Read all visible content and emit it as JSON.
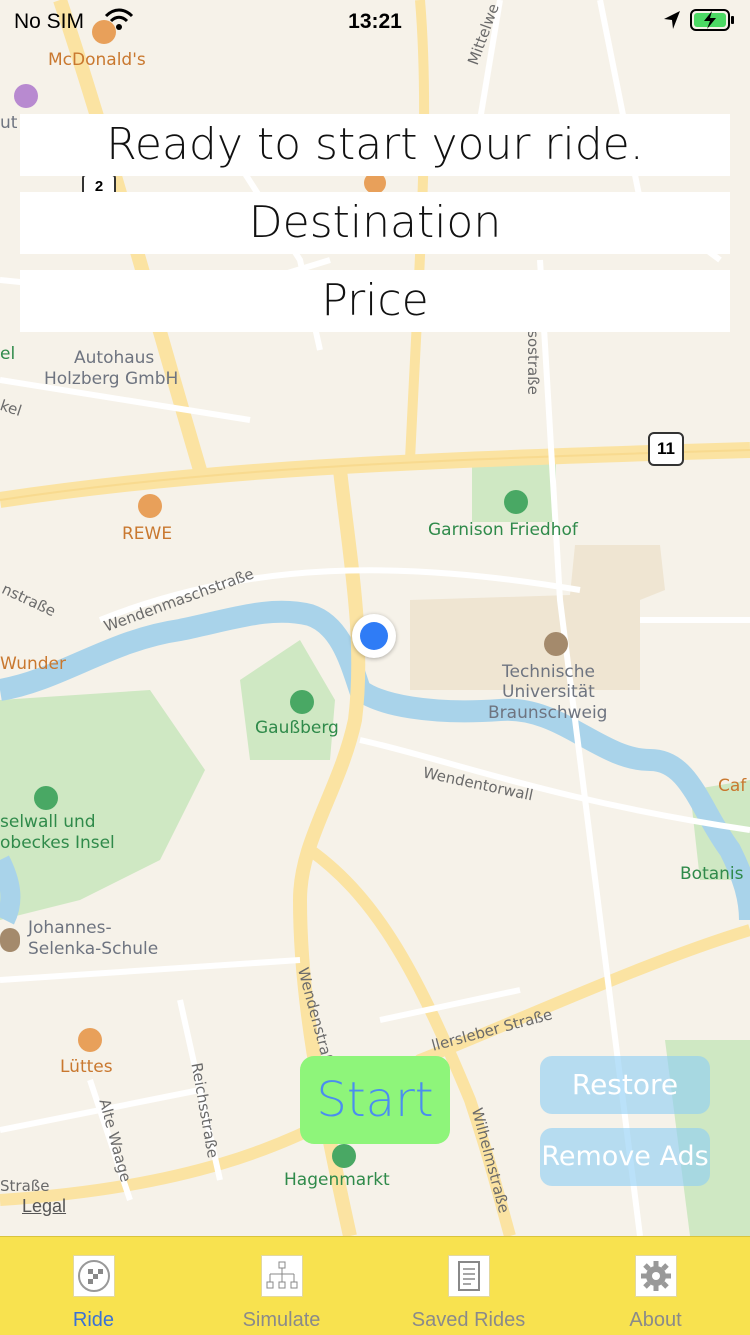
{
  "status_bar": {
    "carrier": "No SIM",
    "time": "13:21"
  },
  "banners": {
    "ride_status": "Ready to start your ride.",
    "destination": "Destination",
    "price": "Price"
  },
  "map": {
    "labels": {
      "mcdonalds": "McDonald's",
      "autohaus": "Autohaus",
      "holzberg": "Holzberg GmbH",
      "rewe": "REWE",
      "garnison": "Garnison Friedhof",
      "tu1": "Technische",
      "tu2": "Universität",
      "tu3": "Braunschweig",
      "gaussberg": "Gaußberg",
      "inselwall1": "selwall und",
      "inselwall2": "obeckes Insel",
      "johannes1": "Johannes-",
      "johannes2": "Selenka-Schule",
      "luettes": "Lüttes",
      "hagenmarkt": "Hagenmarkt",
      "botanis": "Botanis",
      "cafe": "Caf",
      "wunder": "Wunder",
      "wendenmasch": "Wendenmaschstraße",
      "wendentorwall": "Wendentorwall",
      "wendenstr": "Wendenstraße",
      "wilhelmstr": "Wilhelmstraße",
      "fallersleber": "llersleber Straße",
      "reichsstr": "Reichsstraße",
      "altewaage": "Alte Waage",
      "strasse_left": "Straße",
      "mittelweg": "Mittelwe",
      "sostrasse": "sostraße",
      "route2": "2",
      "route11": "11",
      "el": "el",
      "kel": "kel",
      "nstrasse": "nstraße",
      "ut": "ut"
    }
  },
  "buttons": {
    "start": "Start",
    "restore": "Restore",
    "remove_ads": "Remove Ads"
  },
  "legal": "Legal",
  "tabs": [
    {
      "label": "Ride",
      "icon": "checkered-flag-icon"
    },
    {
      "label": "Simulate",
      "icon": "hierarchy-icon"
    },
    {
      "label": "Saved Rides",
      "icon": "document-icon"
    },
    {
      "label": "About",
      "icon": "gear-icon"
    }
  ],
  "colors": {
    "tabbar": "#f8e24f",
    "active_tab": "#3a72d6",
    "start_button": "#8ef57a",
    "location_dot": "#2f7cf6"
  }
}
